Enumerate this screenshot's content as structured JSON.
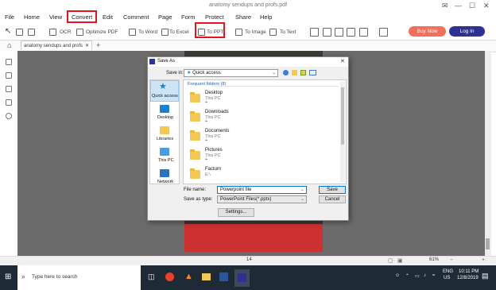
{
  "window": {
    "title": "anatomy sendups and profs.pdf",
    "controls": [
      "✉",
      "—",
      "☐",
      "✕"
    ]
  },
  "menu": {
    "items": [
      "File",
      "Home",
      "View",
      "Convert",
      "Edit",
      "Comment",
      "Page",
      "Form",
      "Protect",
      "Share",
      "Help"
    ],
    "highlight_color": "#e3141e"
  },
  "toolbar": {
    "ocr": "OCR",
    "optimize": "Optimize PDF",
    "to_word": "To Word",
    "to_excel": "To Excel",
    "to_ppt": "To PPT",
    "to_image": "To Image",
    "to_text": "To Text",
    "buy_now": "Buy Now",
    "login": "Log In",
    "buy_color": "#f1705b",
    "login_color": "#2e3192"
  },
  "tabs": {
    "doc_tab": "anatomy sendups and profs",
    "close": "✕",
    "add": "+"
  },
  "status": {
    "page_num": "14",
    "zoom": "61%"
  },
  "dialog": {
    "title": "Save As",
    "save_in_label": "Save in:",
    "save_in_value": "Quick access",
    "places": [
      {
        "label": "Quick access",
        "icon": "star-icon"
      },
      {
        "label": "Desktop",
        "icon": "desktop-icon"
      },
      {
        "label": "Libraries",
        "icon": "libraries-icon"
      },
      {
        "label": "This PC",
        "icon": "computer-icon"
      },
      {
        "label": "Network",
        "icon": "network-icon"
      }
    ],
    "group_header": "Frequent folders (8)",
    "folders": [
      {
        "name": "Desktop",
        "sub": "This PC"
      },
      {
        "name": "Downloads",
        "sub": "This PC"
      },
      {
        "name": "Documents",
        "sub": "This PC"
      },
      {
        "name": "Pictures",
        "sub": "This PC"
      },
      {
        "name": "Factum",
        "sub": "E:\\"
      }
    ],
    "file_name_label": "File name:",
    "file_name_value": "Powerpoint file",
    "save_type_label": "Save as type:",
    "save_type_value": "PowerPoint Files(*.pptx)",
    "save_button": "Save",
    "cancel_button": "Cancel",
    "settings_button": "Settings..."
  },
  "taskbar": {
    "search_placeholder": "Type here to search",
    "time": "10:11 PM",
    "date": "12/8/2019",
    "lang": "ENG",
    "region": "US"
  }
}
